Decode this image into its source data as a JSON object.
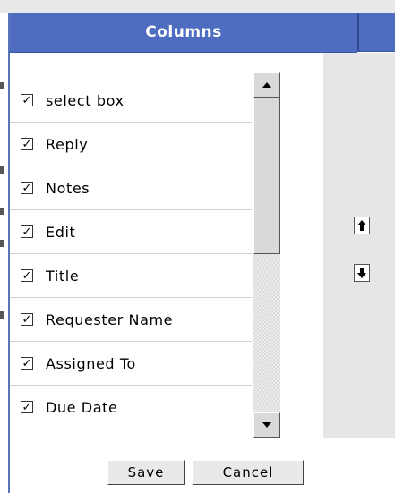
{
  "dialog": {
    "title": "Columns"
  },
  "columns": [
    {
      "label": "select box",
      "checked": true
    },
    {
      "label": "Reply",
      "checked": true
    },
    {
      "label": "Notes",
      "checked": true
    },
    {
      "label": "Edit",
      "checked": true
    },
    {
      "label": "Title",
      "checked": true
    },
    {
      "label": "Requester Name",
      "checked": true
    },
    {
      "label": "Assigned To",
      "checked": true
    },
    {
      "label": "Due Date",
      "checked": true
    }
  ],
  "checkmark": "✓",
  "icons": {
    "move_up": "arrow-up-icon",
    "move_down": "arrow-down-icon",
    "scroll_up": "scroll-up-icon",
    "scroll_down": "scroll-down-icon"
  },
  "footer": {
    "save_label": "Save",
    "cancel_label": "Cancel"
  },
  "colors": {
    "header_bg": "#4e6cc0",
    "panel_bg": "#e6e6e6"
  }
}
